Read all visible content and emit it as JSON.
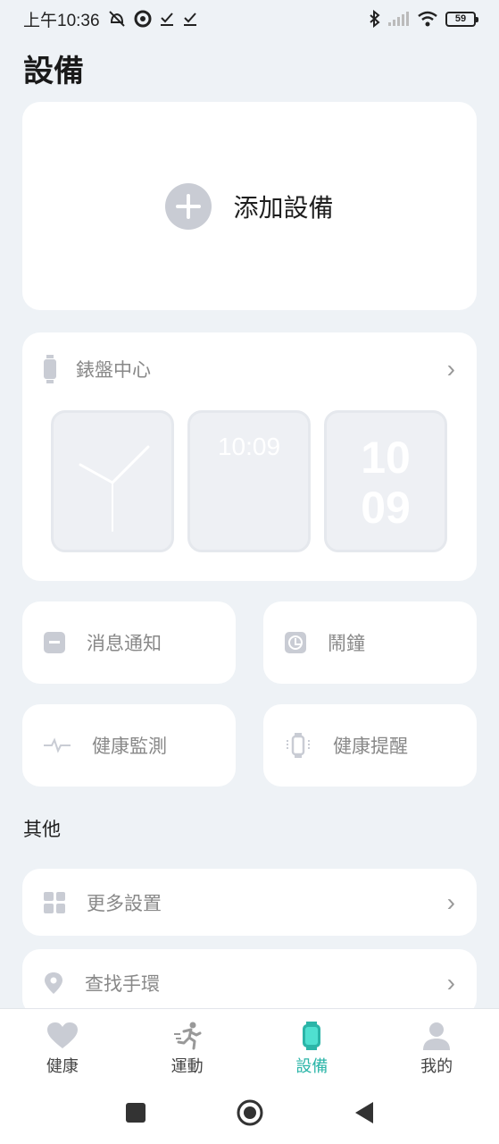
{
  "status_bar": {
    "time": "上午10:36",
    "battery": "59",
    "icons": [
      "alarm-off-icon",
      "aperture-icon",
      "check-icon",
      "check-icon",
      "bluetooth-icon",
      "signal-icon",
      "wifi-icon",
      "battery-icon"
    ]
  },
  "page": {
    "title": "設備"
  },
  "add_device": {
    "label": "添加設備",
    "icon": "plus-circle-icon"
  },
  "dial_center": {
    "title": "錶盤中心",
    "dials": [
      {
        "type": "analog"
      },
      {
        "type": "digital",
        "time": "10:09"
      },
      {
        "type": "digital-stacked",
        "hours": "10",
        "minutes": "09"
      }
    ]
  },
  "tiles": [
    {
      "label": "消息通知",
      "icon": "message-icon"
    },
    {
      "label": "鬧鐘",
      "icon": "clock-icon"
    },
    {
      "label": "健康監測",
      "icon": "pulse-icon"
    },
    {
      "label": "健康提醒",
      "icon": "vibrate-watch-icon"
    }
  ],
  "other": {
    "section_title": "其他",
    "rows": [
      {
        "label": "更多設置",
        "icon": "grid-icon"
      },
      {
        "label": "查找手環",
        "icon": "location-pin-icon"
      }
    ]
  },
  "tab_bar": {
    "tabs": [
      {
        "label": "健康",
        "icon": "heart-icon",
        "active": false
      },
      {
        "label": "運動",
        "icon": "runner-icon",
        "active": false
      },
      {
        "label": "設備",
        "icon": "watch-icon",
        "active": true
      },
      {
        "label": "我的",
        "icon": "person-icon",
        "active": false
      }
    ],
    "active_color": "#2bb5a8"
  },
  "colors": {
    "background": "#eef2f6",
    "card": "#ffffff",
    "icon_gray": "#c9ccd4",
    "accent": "#2bb5a8"
  }
}
